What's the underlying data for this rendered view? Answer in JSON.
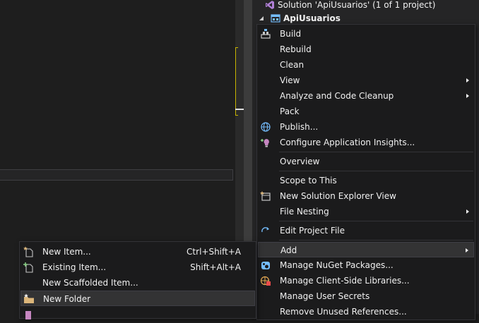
{
  "solution_explorer": {
    "solution_label": "Solution 'ApiUsuarios' (1 of 1 project)",
    "project_label": "ApiUsuarios"
  },
  "context_menu": {
    "items": [
      {
        "label": "Build",
        "icon": "build-icon"
      },
      {
        "label": "Rebuild"
      },
      {
        "label": "Clean"
      },
      {
        "label": "View",
        "submenu": true
      },
      {
        "label": "Analyze and Code Cleanup",
        "submenu": true
      },
      {
        "label": "Pack"
      },
      {
        "label": "Publish...",
        "icon": "globe-icon"
      },
      {
        "label": "Configure Application Insights...",
        "icon": "lightbulb-plus-icon"
      },
      {
        "label": "Overview"
      },
      {
        "label": "Scope to This"
      },
      {
        "label": "New Solution Explorer View",
        "icon": "new-view-icon"
      },
      {
        "label": "File Nesting",
        "submenu": true
      },
      {
        "label": "Edit Project File",
        "icon": "refresh-arrow-icon"
      },
      {
        "label": "Add",
        "submenu": true,
        "highlighted": true
      },
      {
        "label": "Manage NuGet Packages...",
        "icon": "nuget-icon"
      },
      {
        "label": "Manage Client-Side Libraries...",
        "icon": "libman-icon"
      },
      {
        "label": "Manage User Secrets"
      },
      {
        "label": "Remove Unused References..."
      }
    ]
  },
  "add_submenu": {
    "items": [
      {
        "label": "New Item...",
        "shortcut": "Ctrl+Shift+A",
        "icon": "new-item-icon"
      },
      {
        "label": "Existing Item...",
        "shortcut": "Shift+Alt+A",
        "icon": "existing-item-icon"
      },
      {
        "label": "New Scaffolded Item..."
      },
      {
        "label": "New Folder",
        "icon": "folder-icon",
        "highlighted": true
      }
    ]
  },
  "colors": {
    "background": "#1e1e1e",
    "menu_bg": "#1b1b1c",
    "highlight": "#333334",
    "text": "#f1f1f1",
    "accent_blue": "#75beff",
    "folder_yellow": "#dcb67a"
  }
}
